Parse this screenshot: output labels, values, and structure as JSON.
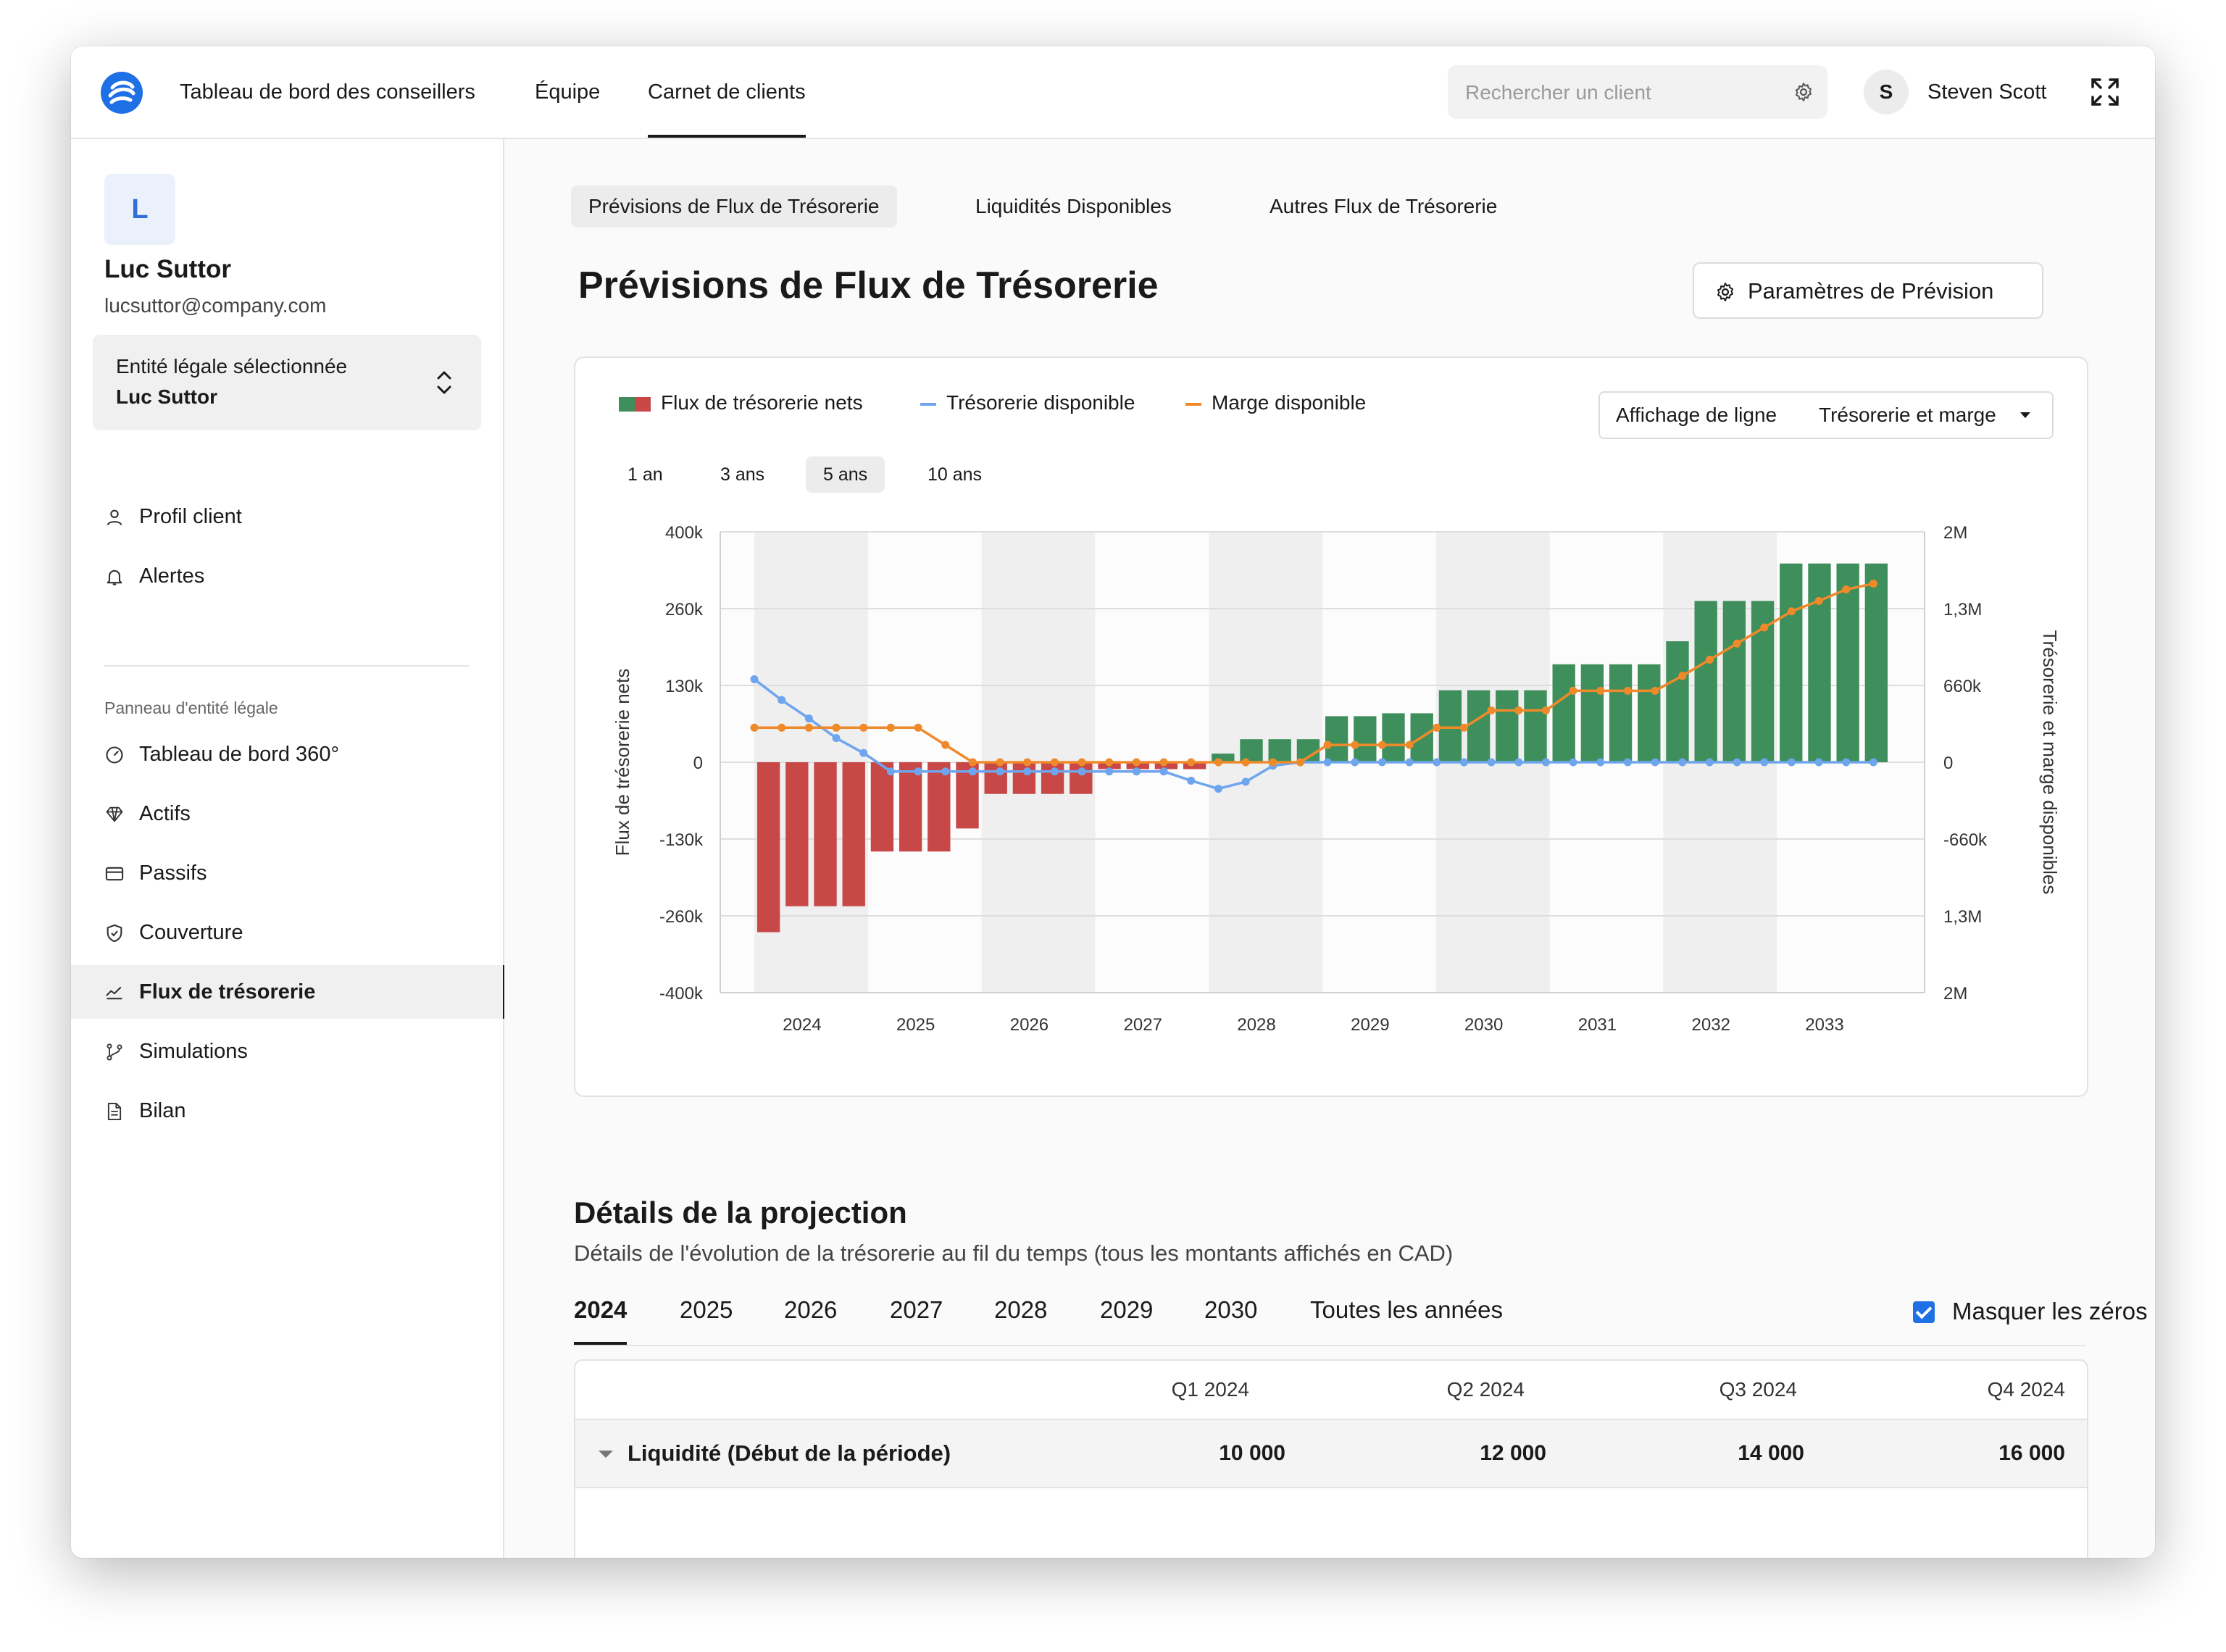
{
  "topbar": {
    "nav": [
      "Tableau de bord des conseillers",
      "Équipe",
      "Carnet de clients"
    ],
    "active_nav": 2,
    "search_placeholder": "Rechercher un client",
    "user_initial": "S",
    "user_name": "Steven Scott"
  },
  "sidebar": {
    "client_initial": "L",
    "client_name": "Luc Suttor",
    "client_email": "lucsuttor@company.com",
    "entity_label": "Entité légale sélectionnée",
    "entity_value": "Luc Suttor",
    "top_items": [
      {
        "label": "Profil client",
        "icon": "user-icon"
      },
      {
        "label": "Alertes",
        "icon": "bell-icon"
      }
    ],
    "section_title": "Panneau d'entité légale",
    "items": [
      {
        "label": "Tableau de bord 360°",
        "icon": "gauge-icon"
      },
      {
        "label": "Actifs",
        "icon": "diamond-icon"
      },
      {
        "label": "Passifs",
        "icon": "credit-card-icon"
      },
      {
        "label": "Couverture",
        "icon": "shield-icon"
      },
      {
        "label": "Flux de trésorerie",
        "icon": "chart-line-icon"
      },
      {
        "label": "Simulations",
        "icon": "git-branch-icon"
      },
      {
        "label": "Bilan",
        "icon": "document-icon"
      }
    ],
    "active_item": 4
  },
  "main": {
    "subtabs": [
      "Prévisions de Flux de Trésorerie",
      "Liquidités Disponibles",
      "Autres Flux de Trésorerie"
    ],
    "active_subtab": 0,
    "title": "Prévisions de Flux de Trésorerie",
    "param_button": "Paramètres de Prévision",
    "legend": {
      "net": "Flux de trésorerie nets",
      "cash": "Trésorerie disponible",
      "margin": "Marge disponible"
    },
    "line_display_label": "Affichage de ligne",
    "line_display_value": "Trésorerie et marge",
    "ranges": [
      "1 an",
      "3 ans",
      "5 ans",
      "10 ans"
    ],
    "active_range": 2,
    "projection_title": "Détails de la projection",
    "projection_sub": "Détails de l'évolution de la trésorerie au fil du temps (tous les montants affichés en CAD)",
    "year_tabs": [
      "2024",
      "2025",
      "2026",
      "2027",
      "2028",
      "2029",
      "2030",
      "Toutes les années"
    ],
    "active_year": 0,
    "hide_zeros": "Masquer les zéros",
    "table": {
      "columns": [
        "Q1 2024",
        "Q2 2024",
        "Q3 2024",
        "Q4 2024"
      ],
      "row_label": "Liquidité (Début de la période)",
      "row_values": [
        "10 000",
        "12 000",
        "14 000",
        "16 000"
      ]
    }
  },
  "colors": {
    "positive": "#3f8f5c",
    "negative": "#c84848",
    "cash_line": "#6ea5ee",
    "margin_line": "#ef8a2a",
    "accent": "#1f6fe5"
  },
  "chart_data": {
    "type": "bar",
    "x_ticks": [
      "2024",
      "2025",
      "2026",
      "2027",
      "2028",
      "2029",
      "2030",
      "2031",
      "2032",
      "2033"
    ],
    "y_left_label": "Flux de trésorerie nets",
    "y_right_label": "Trésorerie et marge disponibles",
    "y_left_ticks": [
      "400k",
      "260k",
      "130k",
      "0",
      "-130k",
      "-260k",
      "-400k"
    ],
    "y_right_ticks": [
      "2M",
      "1,3M",
      "660k",
      "0",
      "-660k",
      "1,3M",
      "2M"
    ],
    "ylim_left": [
      -400000,
      400000
    ],
    "ylim_right": [
      -2000000,
      2000000
    ],
    "quarters_per_year": 4,
    "series": [
      {
        "name": "Flux de trésorerie nets",
        "kind": "bar",
        "values": [
          -295000,
          -250000,
          -250000,
          -250000,
          -155000,
          -155000,
          -155000,
          -115000,
          -55000,
          -55000,
          -55000,
          -55000,
          -12000,
          -12000,
          -12000,
          -12000,
          15000,
          40000,
          40000,
          40000,
          80000,
          80000,
          85000,
          85000,
          125000,
          125000,
          125000,
          125000,
          170000,
          170000,
          170000,
          170000,
          210000,
          280000,
          280000,
          280000,
          345000,
          345000,
          345000,
          345000
        ]
      },
      {
        "name": "Trésorerie disponible",
        "kind": "line",
        "values": [
          720000,
          540000,
          380000,
          210000,
          80000,
          -80000,
          -80000,
          -80000,
          -80000,
          -80000,
          -80000,
          -80000,
          -80000,
          -80000,
          -80000,
          -80000,
          -160000,
          -230000,
          -170000,
          -30000,
          0,
          0,
          0,
          0,
          0,
          0,
          0,
          0,
          0,
          0,
          0,
          0,
          0,
          0,
          0,
          0,
          0,
          0,
          0,
          0,
          0,
          0
        ]
      },
      {
        "name": "Marge disponible",
        "kind": "line",
        "values": [
          300000,
          300000,
          300000,
          300000,
          300000,
          300000,
          300000,
          150000,
          0,
          0,
          0,
          0,
          0,
          0,
          0,
          0,
          0,
          0,
          0,
          0,
          0,
          150000,
          150000,
          150000,
          150000,
          300000,
          300000,
          450000,
          450000,
          450000,
          620000,
          620000,
          620000,
          620000,
          750000,
          890000,
          1030000,
          1170000,
          1310000,
          1400000,
          1500000,
          1550000
        ]
      }
    ],
    "grid": true,
    "legend_position": "top-left"
  }
}
